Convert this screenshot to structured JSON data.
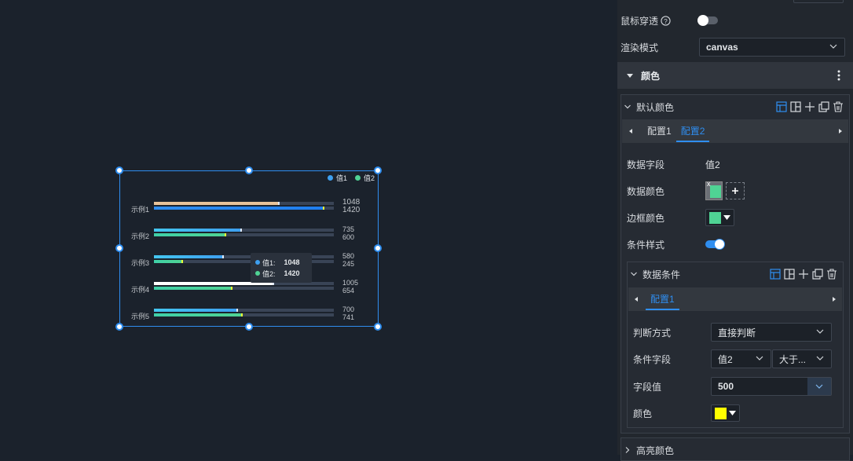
{
  "chart_data": {
    "type": "bar",
    "orientation": "horizontal",
    "categories": [
      "示例1",
      "示例2",
      "示例3",
      "示例4",
      "示例5"
    ],
    "series": [
      {
        "name": "值1",
        "values": [
          1048,
          735,
          580,
          1005,
          700
        ]
      },
      {
        "name": "值2",
        "values": [
          1420,
          600,
          245,
          654,
          741
        ]
      }
    ],
    "xlim": [
      0,
      1500
    ],
    "legend_position": "top-right"
  },
  "colors": {
    "accent": "#2f8ef0",
    "series1": "#3ea0f0",
    "series2": "#4fd394",
    "highlight1": "#e8c39a",
    "highlight_end": "#e6ff35",
    "condition_color": "#ffff00"
  },
  "legend": [
    {
      "label": "值1",
      "color": "#3ea0f0"
    },
    {
      "label": "值2",
      "color": "#4fd394"
    }
  ],
  "tooltip": {
    "rows": [
      {
        "label": "值1:",
        "value": "1048",
        "color": "#3ea0f0"
      },
      {
        "label": "值2:",
        "value": "1420",
        "color": "#4fd394"
      }
    ]
  },
  "panel": {
    "mouse_through_label": "鼠标穿透",
    "render_mode_label": "渲染模式",
    "render_mode_value": "canvas",
    "section_title": "颜色",
    "default_color_title": "默认颜色",
    "config_tabs": [
      "配置1",
      "配置2"
    ],
    "data_field_label": "数据字段",
    "data_field_value": "值2",
    "data_color_label": "数据颜色",
    "border_color_label": "边框颜色",
    "cond_style_label": "条件样式",
    "data_cond_title": "数据条件",
    "cond_tabs": [
      "配置1"
    ],
    "judge_label": "判断方式",
    "judge_value": "直接判断",
    "cond_field_label": "条件字段",
    "cond_field_value": "值2",
    "cond_op_value": "大于...",
    "field_value_label": "字段值",
    "field_value_value": "500",
    "color_label": "颜色",
    "highlight_title": "高亮颜色"
  }
}
